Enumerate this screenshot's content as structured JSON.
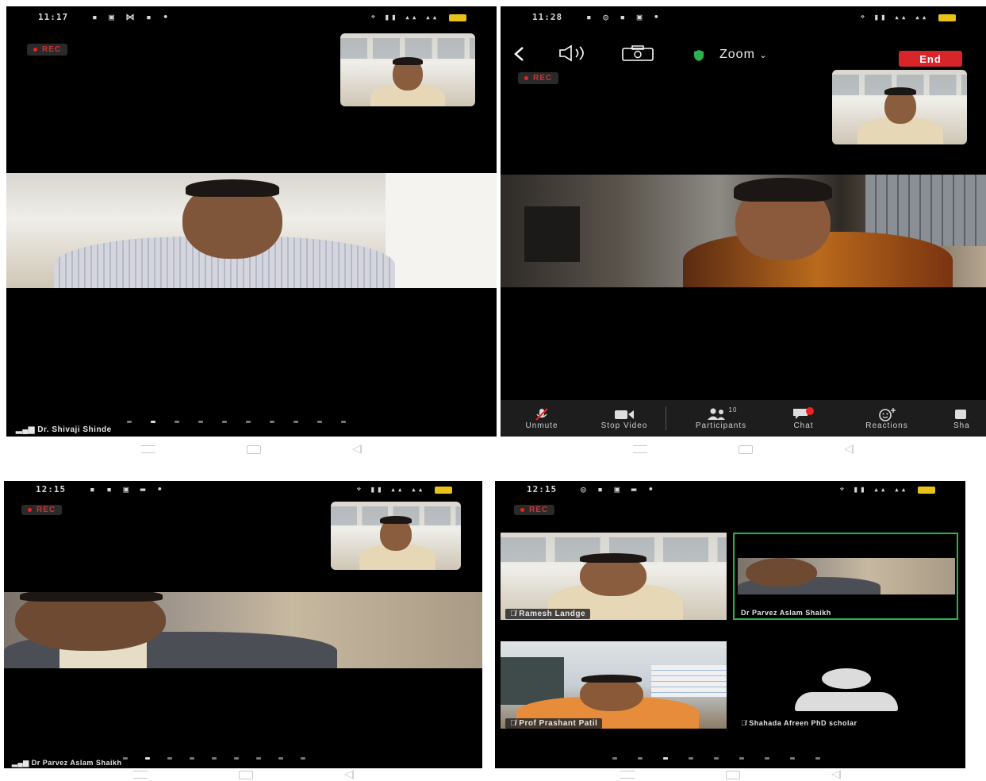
{
  "panel1": {
    "status_time": "11:17",
    "rec_label": "REC",
    "speaker_name": "Dr. Shivaji Shinde"
  },
  "panel2": {
    "status_time": "11:28",
    "rec_label": "REC",
    "meeting_label": "Zoom",
    "end_label": "End",
    "toolbar": {
      "unmute": "Unmute",
      "stop_video": "Stop Video",
      "participants": "Participants",
      "participants_count": "10",
      "chat": "Chat",
      "reactions": "Reactions",
      "share": "Sha"
    }
  },
  "panel3": {
    "status_time": "12:15",
    "rec_label": "REC",
    "speaker_name": "Dr Parvez Aslam Shaikh"
  },
  "panel4": {
    "status_time": "12:15",
    "rec_label": "REC",
    "tiles": [
      {
        "name": "Ramesh Landge"
      },
      {
        "name": "Dr Parvez Aslam Shaikh"
      },
      {
        "name": "Prof Prashant Patil"
      },
      {
        "name": "Shahada Afreen PhD scholar"
      }
    ]
  },
  "colors": {
    "end_button": "#d7262a",
    "active_speaker_border": "#2bb24c",
    "battery": "#e8c21a",
    "shield": "#2bb24c"
  }
}
